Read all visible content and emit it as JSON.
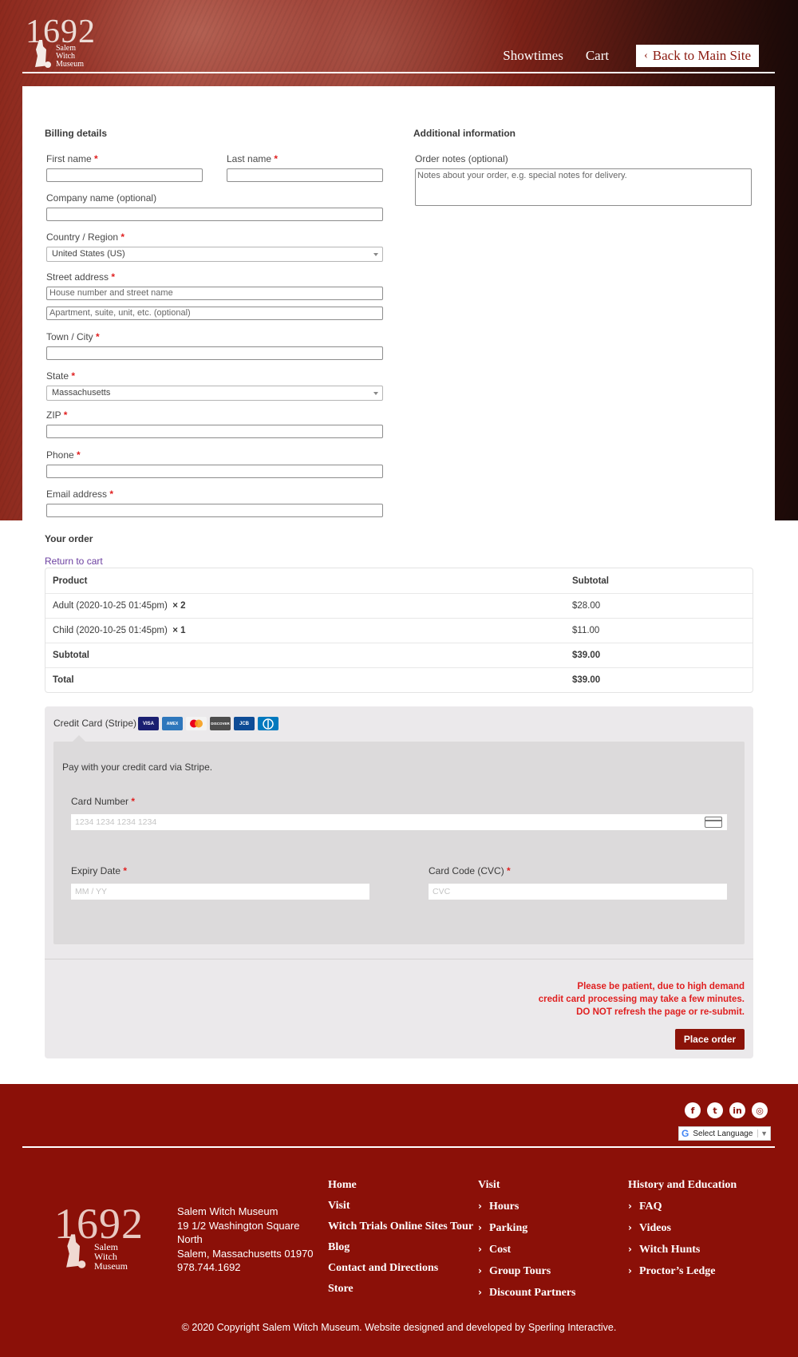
{
  "header": {
    "logo_year": "1692",
    "logo_name_lines": [
      "Salem",
      "Witch",
      "Museum"
    ],
    "nav": {
      "showtimes": "Showtimes",
      "cart": "Cart",
      "back": "Back to Main Site"
    }
  },
  "billing": {
    "title": "Billing details",
    "first_name_label": "First name",
    "last_name_label": "Last name",
    "company_label": "Company name (optional)",
    "country_label": "Country / Region",
    "country_value": "United States (US)",
    "street_label": "Street address",
    "street_placeholder": "House number and street name",
    "street2_placeholder": "Apartment, suite, unit, etc. (optional)",
    "city_label": "Town / City",
    "state_label": "State",
    "state_value": "Massachusetts",
    "zip_label": "ZIP",
    "phone_label": "Phone",
    "email_label": "Email address",
    "required_mark": "*"
  },
  "additional": {
    "title": "Additional information",
    "notes_label": "Order notes (optional)",
    "notes_placeholder": "Notes about your order, e.g. special notes for delivery."
  },
  "order": {
    "title": "Your order",
    "return_link": "Return to cart",
    "col_product": "Product",
    "col_subtotal": "Subtotal",
    "items": [
      {
        "name": "Adult (2020-10-25 01:45pm)",
        "qty": "× 2",
        "total": "$28.00"
      },
      {
        "name": "Child (2020-10-25 01:45pm)",
        "qty": "× 1",
        "total": "$11.00"
      }
    ],
    "subtotal_label": "Subtotal",
    "subtotal_value": "$39.00",
    "total_label": "Total",
    "total_value": "$39.00"
  },
  "payment": {
    "method_label": "Credit Card (Stripe)",
    "card_brands": [
      "VISA",
      "AMEX",
      "MC",
      "DISCOVER",
      "JCB",
      "DINERS"
    ],
    "description": "Pay with your credit card via Stripe.",
    "card_number_label": "Card Number",
    "card_number_placeholder": "1234 1234 1234 1234",
    "expiry_label": "Expiry Date",
    "expiry_placeholder": "MM / YY",
    "cvc_label": "Card Code (CVC)",
    "cvc_placeholder": "CVC",
    "warning_lines": [
      "Please be patient, due to high demand",
      "credit card processing may take a few minutes.",
      "DO NOT refresh the page or re-submit."
    ],
    "place_order": "Place order"
  },
  "footer": {
    "language": "Select Language",
    "address_lines": [
      "Salem Witch Museum",
      "19 1/2 Washington Square",
      "North",
      "Salem, Massachusetts 01970",
      "978.744.1692"
    ],
    "col1": [
      "Home",
      "Visit",
      "Witch Trials Online Sites Tour",
      "Blog",
      "Contact and Directions",
      "Store"
    ],
    "col2_title": "Visit",
    "col2": [
      "Hours",
      "Parking",
      "Cost",
      "Group Tours",
      "Discount Partners"
    ],
    "col3_title": "History and Education",
    "col3": [
      "FAQ",
      "Videos",
      "Witch Hunts",
      "Proctor’s Ledge"
    ],
    "copyright": "© 2020 Copyright Salem Witch Museum. Website designed and developed by Sperling Interactive."
  },
  "colors": {
    "brand_red": "#8b1008",
    "required_red": "#e02020",
    "link_purple": "#6b3fa0"
  }
}
